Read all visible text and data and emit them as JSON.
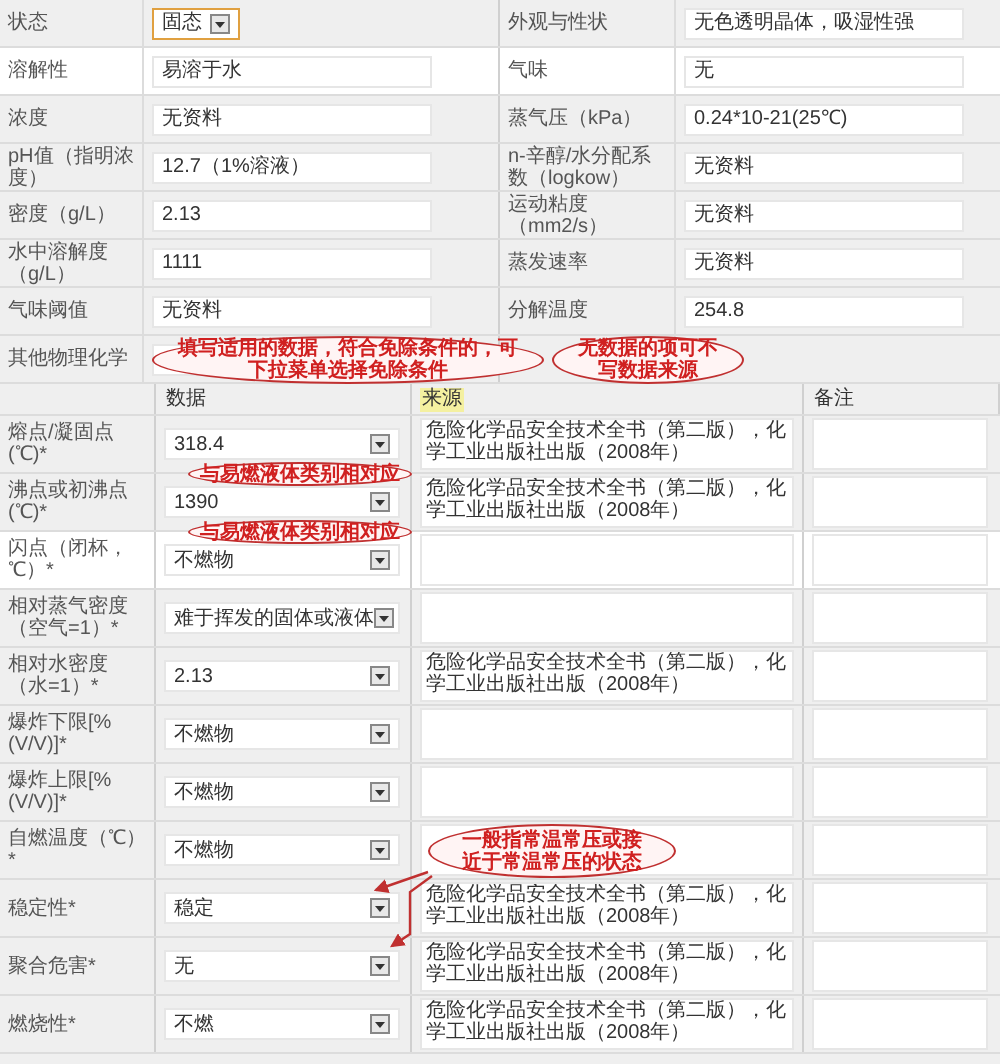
{
  "basic_properties": [
    {
      "highlighted": false,
      "cells": [
        {
          "label": "状态",
          "value": "固态",
          "kind": "select",
          "focused": true
        },
        {
          "label": "外观与性状",
          "value": "无色透明晶体，吸湿性强",
          "kind": "input",
          "focused": false
        }
      ]
    },
    {
      "highlighted": true,
      "cells": [
        {
          "label": "溶解性",
          "value": "易溶于水",
          "kind": "input",
          "focused": false
        },
        {
          "label": "气味",
          "value": "无",
          "kind": "input",
          "focused": false
        }
      ]
    },
    {
      "highlighted": false,
      "cells": [
        {
          "label": "浓度",
          "value": "无资料",
          "kind": "input",
          "focused": false
        },
        {
          "label": "蒸气压（kPa）",
          "value": "0.24*10-21(25℃)",
          "kind": "input",
          "focused": false
        }
      ]
    },
    {
      "highlighted": false,
      "cells": [
        {
          "label": "pH值（指明浓度）",
          "value": "12.7（1%溶液）",
          "kind": "input",
          "focused": false
        },
        {
          "label": "n-辛醇/水分配系数（logkow）",
          "value": "无资料",
          "kind": "input",
          "focused": false
        }
      ]
    },
    {
      "highlighted": false,
      "cells": [
        {
          "label": "密度（g/L）",
          "value": "2.13",
          "kind": "input",
          "focused": false
        },
        {
          "label": "运动粘度（mm2/s）",
          "value": "无资料",
          "kind": "input",
          "focused": false
        }
      ]
    },
    {
      "highlighted": false,
      "cells": [
        {
          "label": "水中溶解度（g/L）",
          "value": "1111",
          "kind": "input",
          "focused": false
        },
        {
          "label": "蒸发速率",
          "value": "无资料",
          "kind": "input",
          "focused": false
        }
      ]
    },
    {
      "highlighted": false,
      "cells": [
        {
          "label": "气味阈值",
          "value": "无资料",
          "kind": "input",
          "focused": false
        },
        {
          "label": "分解温度",
          "value": "254.8",
          "kind": "input",
          "focused": false
        }
      ]
    },
    {
      "highlighted": false,
      "cells": [
        {
          "label": "其他物理化学",
          "kind": "input",
          "focused": false
        },
        {
          "kind": "blank"
        }
      ]
    }
  ],
  "measured_columns": [
    {
      "label": "数据",
      "highlighted": false
    },
    {
      "label": "来源",
      "highlighted": true
    },
    {
      "label": "备注",
      "highlighted": false
    }
  ],
  "measured_properties": [
    {
      "label": "熔点/凝固点(℃)*",
      "value": "318.4",
      "source": "危险化学品安全技术全书（第二版），化学工业出版社出版（2008年）",
      "highlighted": false
    },
    {
      "label": "沸点或初沸点(℃)*",
      "value": "1390",
      "source": "危险化学品安全技术全书（第二版），化学工业出版社出版（2008年）",
      "highlighted": false
    },
    {
      "label": "闪点（闭杯，℃）*",
      "value": "不燃物",
      "highlighted": true
    },
    {
      "label": "相对蒸气密度（空气=1）*",
      "value": "难于挥发的固体或液体",
      "highlighted": false
    },
    {
      "label": "相对水密度（水=1）*",
      "value": "2.13",
      "source": "危险化学品安全技术全书（第二版），化学工业出版社出版（2008年）",
      "highlighted": false
    },
    {
      "label": "爆炸下限[%(V/V)]*",
      "value": "不燃物",
      "highlighted": false
    },
    {
      "label": "爆炸上限[%(V/V)]*",
      "value": "不燃物",
      "highlighted": false
    },
    {
      "label": "自燃温度（℃）*",
      "value": "不燃物",
      "highlighted": false
    },
    {
      "label": "稳定性*",
      "value": "稳定",
      "source": "危险化学品安全技术全书（第二版），化学工业出版社出版（2008年）",
      "highlighted": false
    },
    {
      "label": "聚合危害*",
      "value": "无",
      "source": "危险化学品安全技术全书（第二版），化学工业出版社出版（2008年）",
      "highlighted": false
    },
    {
      "label": "燃烧性*",
      "value": "不燃",
      "source": "危险化学品安全技术全书（第二版），化学工业出版社出版（2008年）",
      "highlighted": false
    }
  ],
  "annotations": [
    {
      "text": "填写适用的数据，符合免除条件的，可下拉菜单选择免除条件"
    },
    {
      "text": "无数据的项可不写数据来源"
    },
    {
      "text": "与易燃液体类别相对应"
    },
    {
      "text": "与易燃液体类别相对应"
    },
    {
      "text": "一般指常温常压或接近于常温常压的状态"
    }
  ]
}
